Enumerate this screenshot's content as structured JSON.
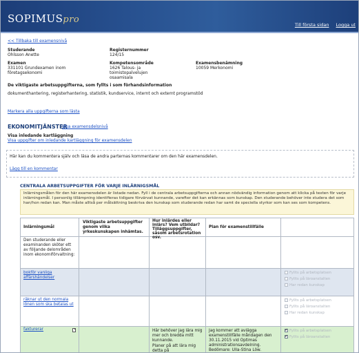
{
  "header": {
    "logo_text": "SOPIMUS",
    "logo_suffix": "pro",
    "links": [
      "Till första sidan",
      "Logga ut"
    ]
  },
  "back_link": "<< Tillbaka till examensnivå",
  "student": {
    "label": "Studerande",
    "value": "Ohlsson Anette",
    "reg_label": "Registernummer",
    "reg_value": "124/15"
  },
  "exam": {
    "label": "Examen",
    "value_lines": [
      "331101 Grundexamen inom",
      "företagsekonomi"
    ],
    "competence_label": "Kompetensområde",
    "competence_lines": [
      "1626 Talous- ja",
      "toimistopalvelujen",
      "osaamisala"
    ],
    "part_label": "Examensbenämning",
    "part_value": "10059 Merkonomi"
  },
  "main_tasks": {
    "label": "De viktigaste arbetsuppgifterna, som fyllts i som förhandsinformation",
    "value": "dokumenthantering, registerhantering, statistik, kundservice, internt och externt programstöd"
  },
  "mark_all_link": "Markera alla uppgifterna som lästa",
  "section": {
    "title": "EKONOMITJÄNSTER",
    "level_link": "Visa examensdelsnivå",
    "mapping_label": "Visa inledande kartläggning",
    "mapping_link": "Visa uppgifter om inledande kartläggning för examensdelen"
  },
  "comments": {
    "intro": "Här kan du kommentera själv och läsa de andra parternas kommentarer om den här examensdelen.",
    "add_link": "Lägg till en kommentar"
  },
  "central": {
    "heading": "CENTRALA ARBETSUPPGIFTER FÖR VARJE INLÄRNIGSMÅL",
    "info": "Inlärningsmålen för den här examensdelen är listade nedan. Fyll i de centrala arbetsuppgifterna och annan nödvändig information genom att klicka på texten för varje inlärningsmål. I personlig tillämpning identifieras tidigare förvärvat kunnande, varefter det kan erkännas som kunskap. Den studerande behöver inte studera det som han/hon redan kan. Man måste alltså per målsättning beskriva den kunskap som studerande redan har samt de speciella styrkor som kan ses som kompetens."
  },
  "table": {
    "headers": [
      "Inlärningsmål",
      "Viktigaste arbetsuppgifter genom vilka yrkeskunskapen inhämtas.",
      "Hur inlärdes eller inlärs? Vem utbildar? Tilläggsuppgifter, såsom arbetsrotation osv.",
      "Plan för examenstillfälle",
      ""
    ],
    "intro_cell": "Den studerande eller examinanden sköter ett av följande delområden inom ekonomiförvaltning:",
    "rows": [
      {
        "goal": "bokför vanliga affärshändelser",
        "checks": [
          "Fyllts på arbetsplatsen",
          "Fyllts på läroanstalten",
          "Har redan kunskap"
        ]
      },
      {
        "goal": "räknar ut den normala lönen som ska betalas ut",
        "checks": [
          "Fyllts på arbetsplatsen",
          "Fyllts på läroanstalten",
          "Har redan kunskap"
        ]
      },
      {
        "goal": "fakturerar",
        "how": "Här behöver jag lära mig mer och bredda mitt kunnande.",
        "how2": "Planer på att lära mig detta på",
        "plan": "Jag kommer att avlägga examenstillfälle måndagen den 30.11.2015 vid Optimas administrationsavdelning. Bedömare: Ulla-Stina Löw.",
        "checks": [
          "Fyllts på arbetsplatsen",
          "Fyllts på läroanstalten"
        ]
      }
    ]
  },
  "colors": {
    "header_bg": "#27508f",
    "link": "#1a4fc4",
    "row_blue": "#dfe6f0",
    "row_green": "#d8f0cf",
    "info_bg": "#fbf6d8"
  }
}
